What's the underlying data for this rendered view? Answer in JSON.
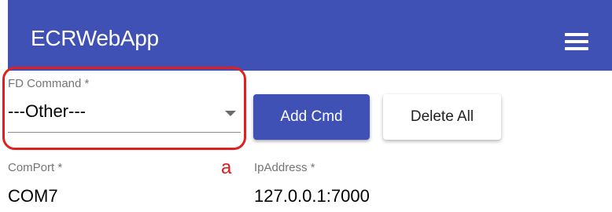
{
  "app": {
    "title": "ECRWebApp",
    "menu_icon": "hamburger-menu-icon",
    "bar_color": "#3f51b5"
  },
  "fd_command": {
    "label": "FD Command *",
    "value": "---Other---",
    "arrow_icon": "dropdown-arrow-icon"
  },
  "buttons": {
    "add_cmd": "Add Cmd",
    "delete_all": "Delete All"
  },
  "annotation": {
    "letter": "a",
    "color": "#e02020"
  },
  "com_port": {
    "label": "ComPort *",
    "value": "COM7"
  },
  "ip_address": {
    "label": "IpAddress *",
    "value": "127.0.0.1:7000"
  }
}
